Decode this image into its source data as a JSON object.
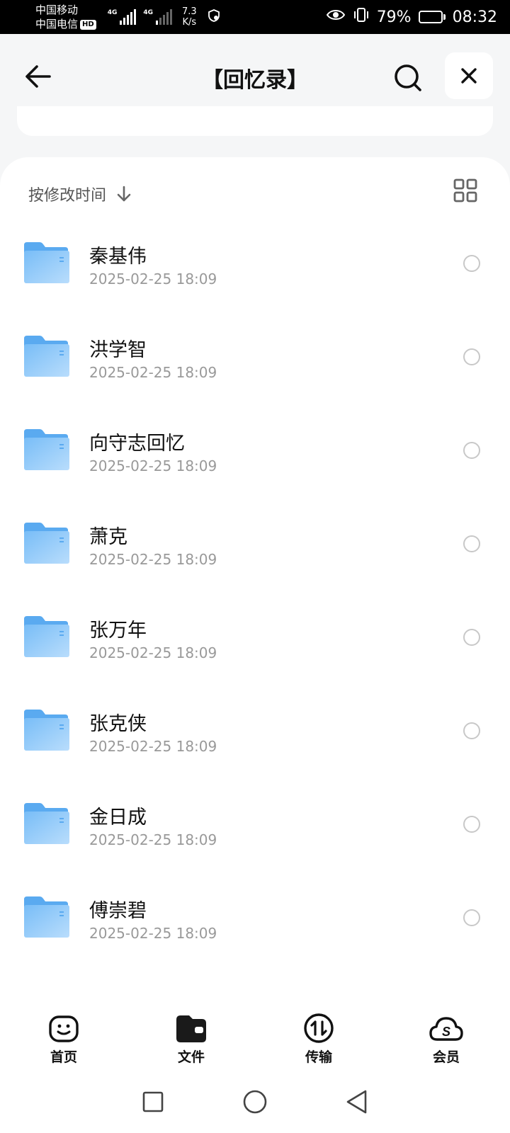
{
  "status_bar": {
    "carrier_1": "中国移动",
    "carrier_2": "中国电信",
    "hd": "HD",
    "network_1": "4G",
    "network_2": "4G",
    "speed_value": "7.3",
    "speed_unit": "K/s",
    "battery_percent": "79%",
    "battery_level": 0.79,
    "time": "08:32"
  },
  "header": {
    "title": "【回忆录】"
  },
  "sort": {
    "label": "按修改时间"
  },
  "files": [
    {
      "name": "秦基伟",
      "date": "2025-02-25 18:09"
    },
    {
      "name": "洪学智",
      "date": "2025-02-25 18:09"
    },
    {
      "name": "向守志回忆",
      "date": "2025-02-25 18:09"
    },
    {
      "name": "萧克",
      "date": "2025-02-25 18:09"
    },
    {
      "name": "张万年",
      "date": "2025-02-25 18:09"
    },
    {
      "name": "张克侠",
      "date": "2025-02-25 18:09"
    },
    {
      "name": "金日成",
      "date": "2025-02-25 18:09"
    },
    {
      "name": "傅崇碧",
      "date": "2025-02-25 18:09"
    }
  ],
  "tabs": [
    {
      "label": "首页",
      "icon": "smile-home-icon"
    },
    {
      "label": "文件",
      "icon": "folder-wallet-icon"
    },
    {
      "label": "传输",
      "icon": "transfer-icon"
    },
    {
      "label": "会员",
      "icon": "cloud-s-icon"
    }
  ],
  "colors": {
    "folder": "#5aaaf0",
    "folder_light": "#a9d4fb",
    "text": "#111111",
    "subtext": "#999999"
  }
}
